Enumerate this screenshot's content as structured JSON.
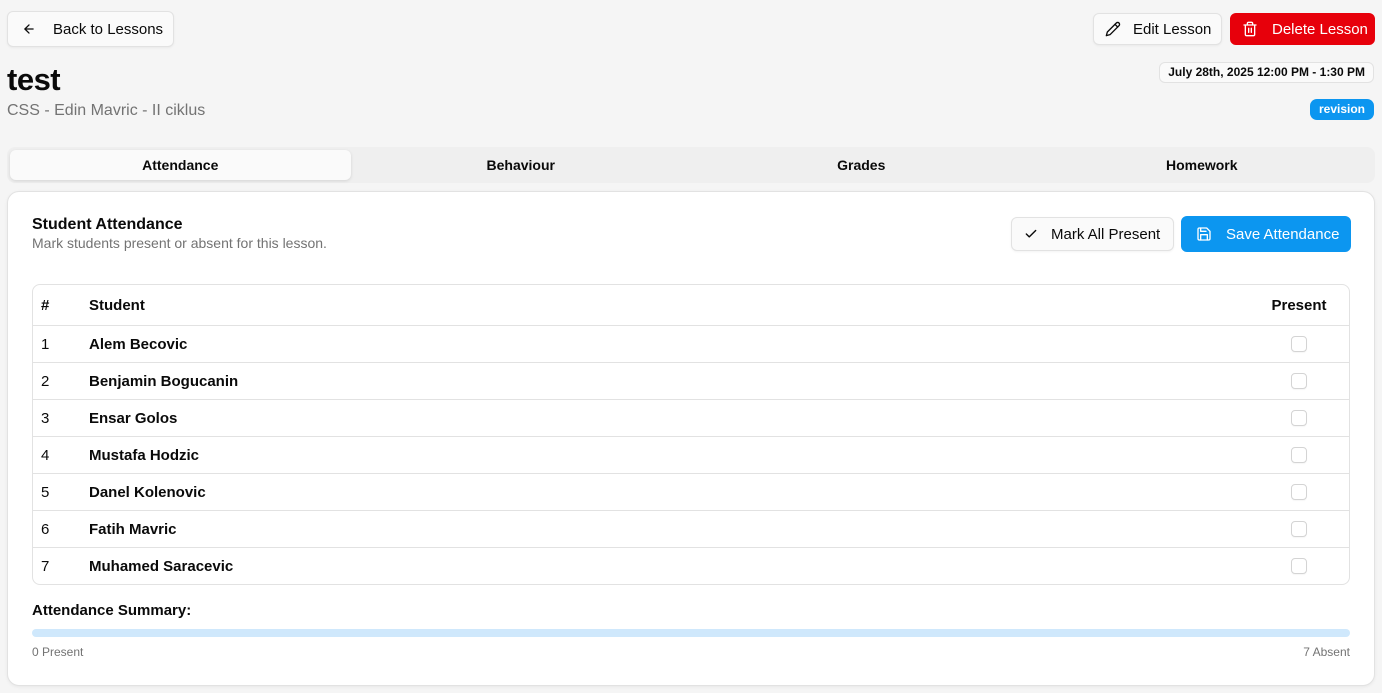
{
  "header": {
    "back_label": "Back to Lessons",
    "edit_label": "Edit Lesson",
    "delete_label": "Delete Lesson"
  },
  "lesson": {
    "title": "test",
    "subtitle": "CSS - Edin Mavric - II ciklus",
    "datetime": "July 28th, 2025 12:00 PM - 1:30 PM",
    "type_badge": "revision"
  },
  "tabs": [
    {
      "label": "Attendance",
      "active": true
    },
    {
      "label": "Behaviour",
      "active": false
    },
    {
      "label": "Grades",
      "active": false
    },
    {
      "label": "Homework",
      "active": false
    }
  ],
  "attendance": {
    "title": "Student Attendance",
    "description": "Mark students present or absent for this lesson.",
    "mark_all_label": "Mark All Present",
    "save_label": "Save Attendance",
    "columns": [
      "#",
      "Student",
      "Present"
    ],
    "students": [
      {
        "num": "1",
        "name": "Alem Becovic",
        "present": false
      },
      {
        "num": "2",
        "name": "Benjamin Bogucanin",
        "present": false
      },
      {
        "num": "3",
        "name": "Ensar Golos",
        "present": false
      },
      {
        "num": "4",
        "name": "Mustafa Hodzic",
        "present": false
      },
      {
        "num": "5",
        "name": "Danel Kolenovic",
        "present": false
      },
      {
        "num": "6",
        "name": "Fatih Mavric",
        "present": false
      },
      {
        "num": "7",
        "name": "Muhamed Saracevic",
        "present": false
      }
    ],
    "summary_label": "Attendance Summary:",
    "present_text": "0 Present",
    "absent_text": "7 Absent",
    "present_fraction": 0
  },
  "colors": {
    "accent": "#0c96f0",
    "danger": "#e7000b",
    "progress_track": "#cfe8fc"
  }
}
